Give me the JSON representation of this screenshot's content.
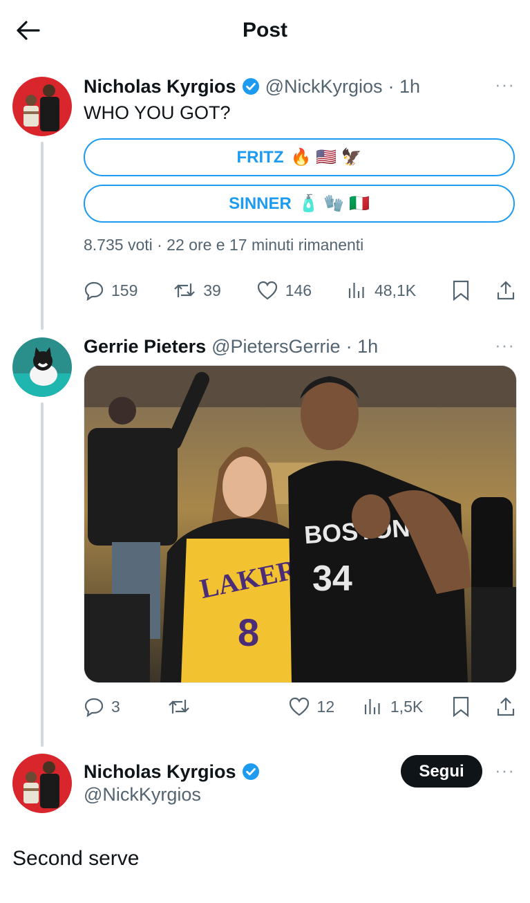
{
  "header": {
    "title": "Post"
  },
  "tweet1": {
    "name": "Nicholas Kyrgios",
    "handle": "@NickKyrgios",
    "time": "· 1h",
    "text": "WHO YOU GOT?",
    "poll": {
      "options": [
        {
          "label": "FRITZ",
          "emoji": "🔥 🇺🇸 🦅"
        },
        {
          "label": "SINNER",
          "emoji": "🧴 🧤 🇮🇹"
        }
      ],
      "info": "8.735 voti · 22 ore e 17 minuti rimanenti"
    },
    "stats": {
      "replies": "159",
      "retweets": "39",
      "likes": "146",
      "views": "48,1K"
    }
  },
  "tweet2": {
    "name": "Gerrie Pieters",
    "handle": "@PietersGerrie",
    "time": "· 1h",
    "stats": {
      "replies": "3",
      "retweets": "",
      "likes": "12",
      "views": "1,5K"
    }
  },
  "main": {
    "name": "Nicholas Kyrgios",
    "handle": "@NickKyrgios",
    "follow_label": "Segui",
    "text": "Second serve"
  },
  "more_label": "···",
  "colors": {
    "accent": "#1d9bf0",
    "text": "#0f1419",
    "muted": "#536471",
    "line": "#cfd9de"
  }
}
